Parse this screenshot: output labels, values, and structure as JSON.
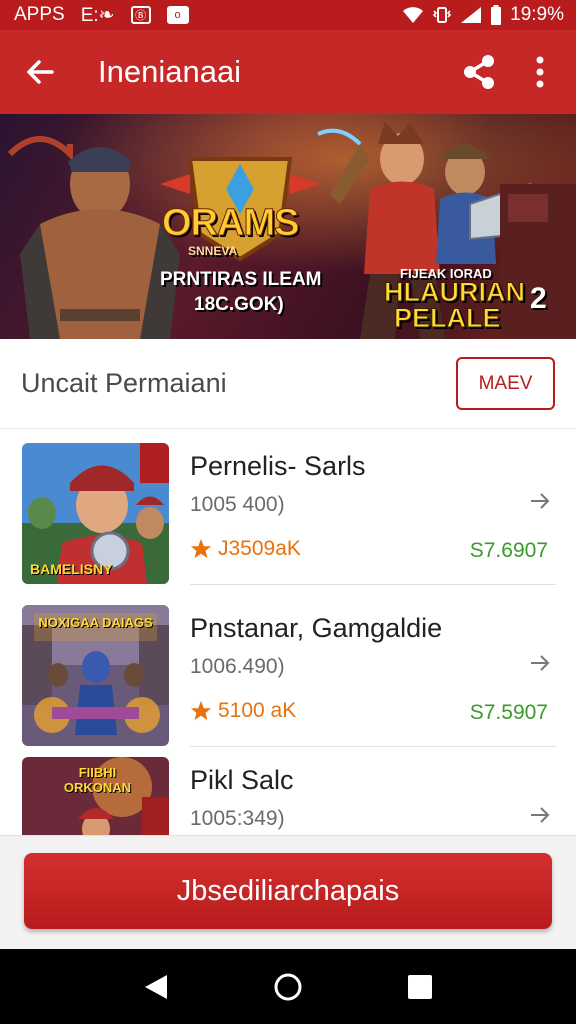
{
  "status_bar": {
    "left_label": "APPS",
    "indicators": [
      "E:❧",
      "Ⓑ",
      "o"
    ],
    "time": "19:9%"
  },
  "app_bar": {
    "title": "Inenianaai",
    "icons": [
      "back-arrow-icon",
      "share-icon",
      "more-vert-icon"
    ]
  },
  "banner": {
    "logo": "ORAMS",
    "logo_sub": "SNNEVA",
    "line1": "PRNTIRAS ILEAM",
    "line2": "18C.GOK)",
    "right_small": "FIJEAK IORAD",
    "right_big_1": "HLAURIAN",
    "right_big_2": "PELALE",
    "number": "2"
  },
  "section": {
    "title": "Uncait Permaiani",
    "button_label": "MAEV"
  },
  "games": [
    {
      "title": "Pernelis- Sarls",
      "subtitle": "1005 400)",
      "rating": "J3509aK",
      "price": "S7.6907",
      "thumb_caption": "BAMELISNY"
    },
    {
      "title": "Pnstanar, Gamgaldie",
      "subtitle": "1006.490)",
      "rating": "5100 aK",
      "price": "S7.5907",
      "thumb_caption": "NOXIGAA DAIAGS"
    },
    {
      "title": "Pikl Salc",
      "subtitle": "1005:349)",
      "rating": "",
      "price": "",
      "thumb_caption": "FIIBHI ORKONAN"
    }
  ],
  "cta": {
    "label": "Jbsediliarchapais"
  },
  "colors": {
    "primary": "#c62828",
    "status": "#b91c1c",
    "rating": "#e8720c",
    "price": "#3a9a2a"
  }
}
